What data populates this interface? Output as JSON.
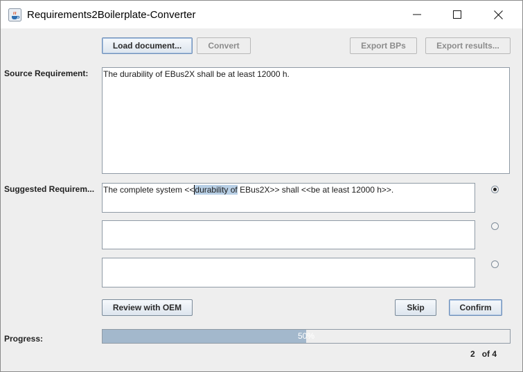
{
  "window": {
    "title": "Requirements2Boilerplate-Converter",
    "controls": {
      "minimize": "─",
      "maximize": "☐",
      "close": "✕"
    }
  },
  "toolbar": {
    "load_label": "Load document...",
    "convert_label": "Convert",
    "export_bps_label": "Export BPs",
    "export_results_label": "Export results..."
  },
  "source": {
    "label": "Source Requirement:",
    "text": "The durability of EBus2X shall be at least 12000 h."
  },
  "suggested": {
    "label": "Suggested Requirem...",
    "items": [
      {
        "text_before": "The complete system <<",
        "text_selected": "durability of",
        "text_after": " EBus2X>> shall <<be at least 12000 h>>.",
        "selected": true
      },
      {
        "text": "",
        "selected": false
      },
      {
        "text": "",
        "selected": false
      }
    ]
  },
  "actions": {
    "review_label": "Review with OEM",
    "skip_label": "Skip",
    "confirm_label": "Confirm"
  },
  "progress": {
    "label": "Progress:",
    "percent_text": "50%",
    "fraction": 0.5,
    "current": "2",
    "of_label": "of",
    "total": "4"
  },
  "colors": {
    "progress_fill": "#a3b8cc",
    "selection": "#b8cfe5"
  }
}
